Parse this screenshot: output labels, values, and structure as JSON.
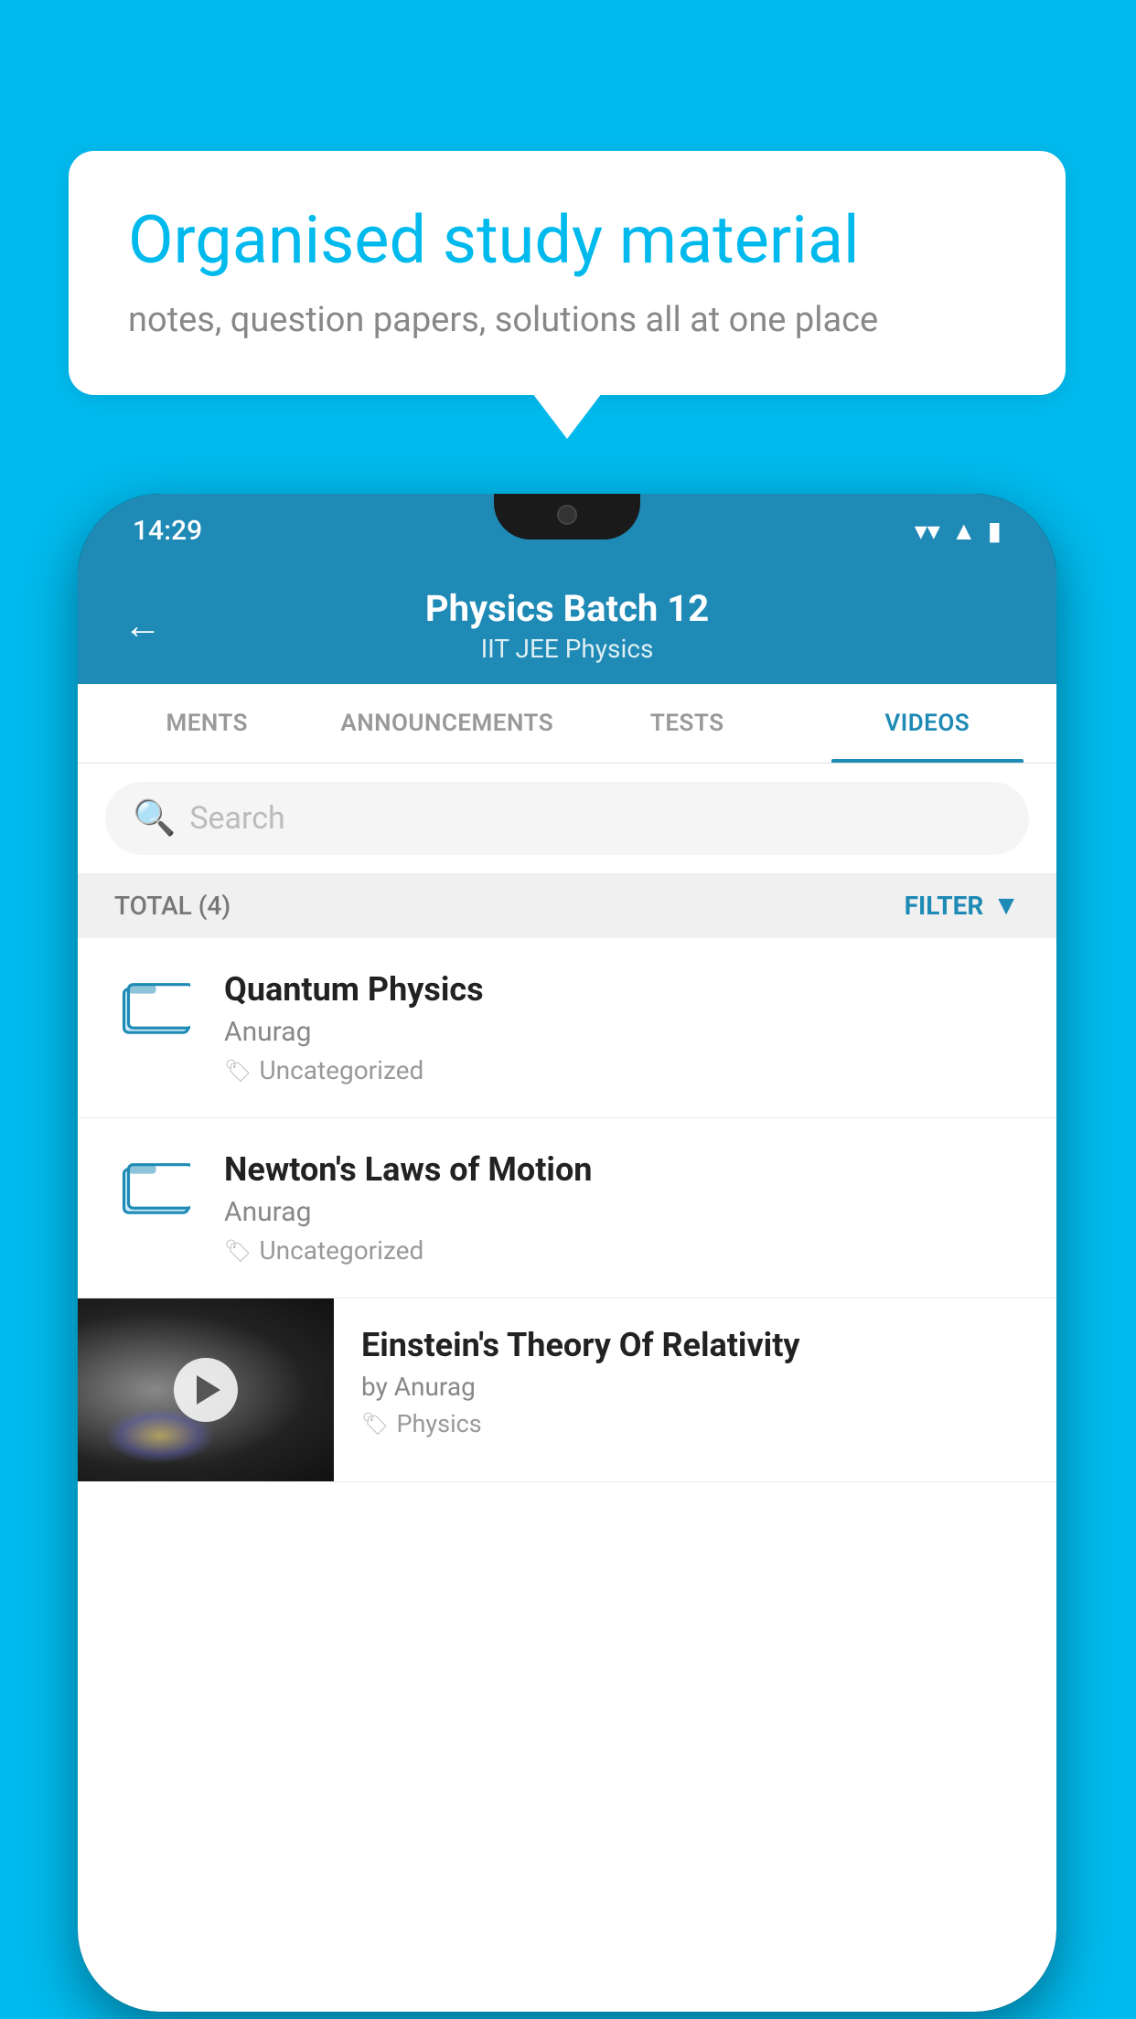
{
  "background_color": "#00BAED",
  "bubble": {
    "title": "Organised study material",
    "subtitle": "notes, question papers, solutions all at one place"
  },
  "phone": {
    "time": "14:29",
    "header": {
      "title": "Physics Batch 12",
      "subtitle": "IIT JEE   Physics",
      "back_label": "←"
    },
    "tabs": [
      {
        "label": "MENTS",
        "active": false
      },
      {
        "label": "ANNOUNCEMENTS",
        "active": false
      },
      {
        "label": "TESTS",
        "active": false
      },
      {
        "label": "VIDEOS",
        "active": true
      }
    ],
    "search": {
      "placeholder": "Search"
    },
    "filter": {
      "total_label": "TOTAL (4)",
      "button_label": "FILTER"
    },
    "videos": [
      {
        "title": "Quantum Physics",
        "author": "Anurag",
        "tag": "Uncategorized",
        "has_thumbnail": false
      },
      {
        "title": "Newton's Laws of Motion",
        "author": "Anurag",
        "tag": "Uncategorized",
        "has_thumbnail": false
      },
      {
        "title": "Einstein's Theory Of Relativity",
        "author": "by Anurag",
        "tag": "Physics",
        "has_thumbnail": true
      }
    ]
  }
}
